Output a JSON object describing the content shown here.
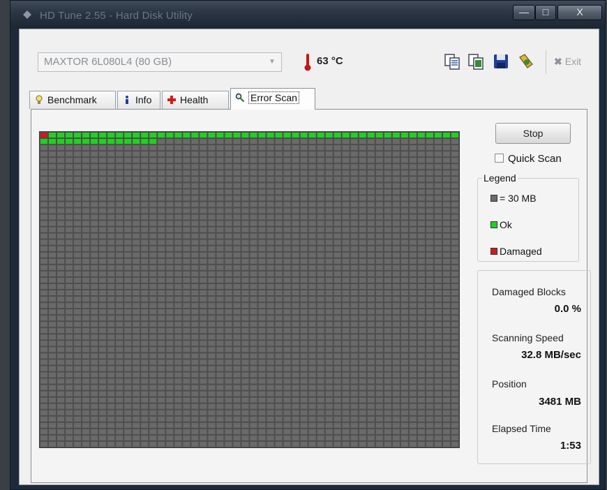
{
  "window": {
    "title": "HD Tune 2.55 - Hard Disk Utility",
    "controls": {
      "minimize": "—",
      "maximize": "□",
      "close": "X"
    }
  },
  "toolbar": {
    "drive": "MAXTOR 6L080L4 (80 GB)",
    "temperature": "63 °C",
    "exit_label": "Exit",
    "icons": [
      "copy-text-icon",
      "copy-screenshot-icon",
      "save-icon",
      "options-icon"
    ]
  },
  "tabs": [
    {
      "label": "Benchmark",
      "icon": "lightbulb-icon",
      "active": false
    },
    {
      "label": "Info",
      "icon": "info-icon",
      "active": false
    },
    {
      "label": "Health",
      "icon": "health-cross-icon",
      "active": false
    },
    {
      "label": "Error Scan",
      "icon": "magnifier-icon",
      "active": true
    }
  ],
  "scan": {
    "stop_label": "Stop",
    "quick_scan_label": "Quick Scan",
    "quick_scan_checked": false,
    "legend_title": "Legend",
    "legend": [
      {
        "label": "= 30 MB",
        "color": "#6a6a6a"
      },
      {
        "label": "Ok",
        "color": "#1fd21f"
      },
      {
        "label": "Damaged",
        "color": "#d11a1a"
      }
    ],
    "grid": {
      "columns": 50,
      "rows": 50,
      "ok_blocks": 64,
      "damaged_blocks": [
        0
      ],
      "colors": {
        "ok": "#1fd21f",
        "damaged": "#d11a1a",
        "pending": "#6a6a6a",
        "gap": "#4e4e4e"
      }
    }
  },
  "stats": {
    "damaged_label": "Damaged Blocks",
    "damaged_value": "0.0 %",
    "speed_label": "Scanning Speed",
    "speed_value": "32.8 MB/sec",
    "position_label": "Position",
    "position_value": "3481 MB",
    "elapsed_label": "Elapsed Time",
    "elapsed_value": "1:53"
  }
}
